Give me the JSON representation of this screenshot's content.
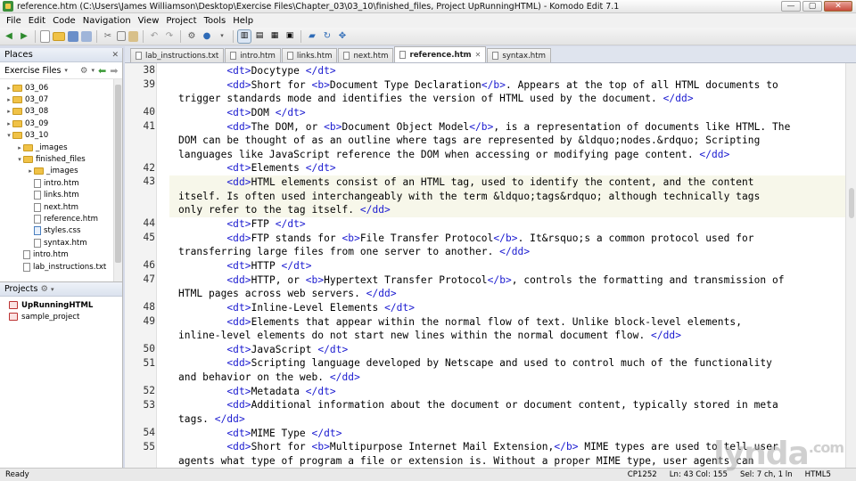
{
  "window": {
    "title": "reference.htm (C:\\Users\\James Williamson\\Desktop\\Exercise Files\\Chapter_03\\03_10\\finished_files, Project UpRunningHTML) - Komodo Edit 7.1",
    "min": "—",
    "max": "▢",
    "close": "✕"
  },
  "menu": [
    "File",
    "Edit",
    "Code",
    "Navigation",
    "View",
    "Project",
    "Tools",
    "Help"
  ],
  "places": {
    "title": "Places",
    "close": "✕",
    "root": "Exercise Files",
    "tree": [
      {
        "label": "03_06",
        "kind": "folder",
        "depth": 0,
        "tw": "▸"
      },
      {
        "label": "03_07",
        "kind": "folder",
        "depth": 0,
        "tw": "▸"
      },
      {
        "label": "03_08",
        "kind": "folder",
        "depth": 0,
        "tw": "▸"
      },
      {
        "label": "03_09",
        "kind": "folder",
        "depth": 0,
        "tw": "▸"
      },
      {
        "label": "03_10",
        "kind": "folder",
        "depth": 0,
        "tw": "▾"
      },
      {
        "label": "_images",
        "kind": "folder",
        "depth": 1,
        "tw": "▸"
      },
      {
        "label": "finished_files",
        "kind": "folder",
        "depth": 1,
        "tw": "▾"
      },
      {
        "label": "_images",
        "kind": "folder",
        "depth": 2,
        "tw": "▸"
      },
      {
        "label": "intro.htm",
        "kind": "file",
        "depth": 2,
        "tw": ""
      },
      {
        "label": "links.htm",
        "kind": "file",
        "depth": 2,
        "tw": ""
      },
      {
        "label": "next.htm",
        "kind": "file",
        "depth": 2,
        "tw": ""
      },
      {
        "label": "reference.htm",
        "kind": "file",
        "depth": 2,
        "tw": ""
      },
      {
        "label": "styles.css",
        "kind": "css",
        "depth": 2,
        "tw": ""
      },
      {
        "label": "syntax.htm",
        "kind": "file",
        "depth": 2,
        "tw": ""
      },
      {
        "label": "intro.htm",
        "kind": "file",
        "depth": 1,
        "tw": ""
      },
      {
        "label": "lab_instructions.txt",
        "kind": "file",
        "depth": 1,
        "tw": ""
      }
    ]
  },
  "projects": {
    "title": "Projects",
    "items": [
      {
        "label": "UpRunningHTML",
        "bold": true
      },
      {
        "label": "sample_project",
        "bold": false
      }
    ]
  },
  "tabs": [
    {
      "label": "lab_instructions.txt",
      "active": false
    },
    {
      "label": "intro.htm",
      "active": false
    },
    {
      "label": "links.htm",
      "active": false
    },
    {
      "label": "next.htm",
      "active": false
    },
    {
      "label": "reference.htm",
      "active": true
    },
    {
      "label": "syntax.htm",
      "active": false
    }
  ],
  "code": [
    {
      "n": "38",
      "lines": [
        "        <dt>Docytype </dt>"
      ]
    },
    {
      "n": "39",
      "lines": [
        "        <dd>Short for <b>Document Type Declaration</b>. Appears at the top of all HTML documents to",
        "trigger standards mode and identifies the version of HTML used by the document. </dd>"
      ]
    },
    {
      "n": "40",
      "lines": [
        "        <dt>DOM </dt>"
      ]
    },
    {
      "n": "41",
      "lines": [
        "        <dd>The DOM, or <b>Document Object Model</b>, is a representation of documents like HTML. The",
        "DOM can be thought of as an outline where tags are represented by &ldquo;nodes.&rdquo; Scripting",
        "languages like JavaScript reference the DOM when accessing or modifying page content. </dd>"
      ]
    },
    {
      "n": "42",
      "lines": [
        "        <dt>Elements </dt>"
      ]
    },
    {
      "n": "43",
      "lines": [
        "        <dd>HTML elements consist of an HTML tag, used to identify the content, and the content",
        "itself. Is often used interchangeably with the term &ldquo;tags&rdquo; although technically tags",
        "only refer to the tag itself. </dd>"
      ]
    },
    {
      "n": "44",
      "lines": [
        "        <dt>FTP </dt>"
      ]
    },
    {
      "n": "45",
      "lines": [
        "        <dd>FTP stands for <b>File Transfer Protocol</b>. It&rsquo;s a common protocol used for",
        "transferring large files from one server to another. </dd>"
      ]
    },
    {
      "n": "46",
      "lines": [
        "        <dt>HTTP </dt>"
      ]
    },
    {
      "n": "47",
      "lines": [
        "        <dd>HTTP, or <b>Hypertext Transfer Protocol</b>, controls the formatting and transmission of",
        "HTML pages across web servers. </dd>"
      ]
    },
    {
      "n": "48",
      "lines": [
        "        <dt>Inline-Level Elements </dt>"
      ]
    },
    {
      "n": "49",
      "lines": [
        "        <dd>Elements that appear within the normal flow of text. Unlike block-level elements,",
        "inline-level elements do not start new lines within the normal document flow. </dd>"
      ]
    },
    {
      "n": "50",
      "lines": [
        "        <dt>JavaScript </dt>"
      ]
    },
    {
      "n": "51",
      "lines": [
        "        <dd>Scripting language developed by Netscape and used to control much of the functionality",
        "and behavior on the web. </dd>"
      ]
    },
    {
      "n": "52",
      "lines": [
        "        <dt>Metadata </dt>"
      ]
    },
    {
      "n": "53",
      "lines": [
        "        <dd>Additional information about the document or document content, typically stored in meta",
        "tags. </dd>"
      ]
    },
    {
      "n": "54",
      "lines": [
        "        <dt>MIME Type </dt>"
      ]
    },
    {
      "n": "55",
      "lines": [
        "        <dd>Short for <b>Multipurpose Internet Mail Extension,</b> MIME types are used to tell user",
        "agents what type of program a file or extension is. Without a proper MIME type, user agents can"
      ]
    }
  ],
  "status": {
    "ready": "Ready",
    "encoding": "CP1252",
    "position": "Ln: 43 Col: 155",
    "selection": "Sel: 7 ch, 1 ln",
    "language": "HTML5"
  },
  "watermark": {
    "text": "lynda",
    "suffix": ".com"
  }
}
